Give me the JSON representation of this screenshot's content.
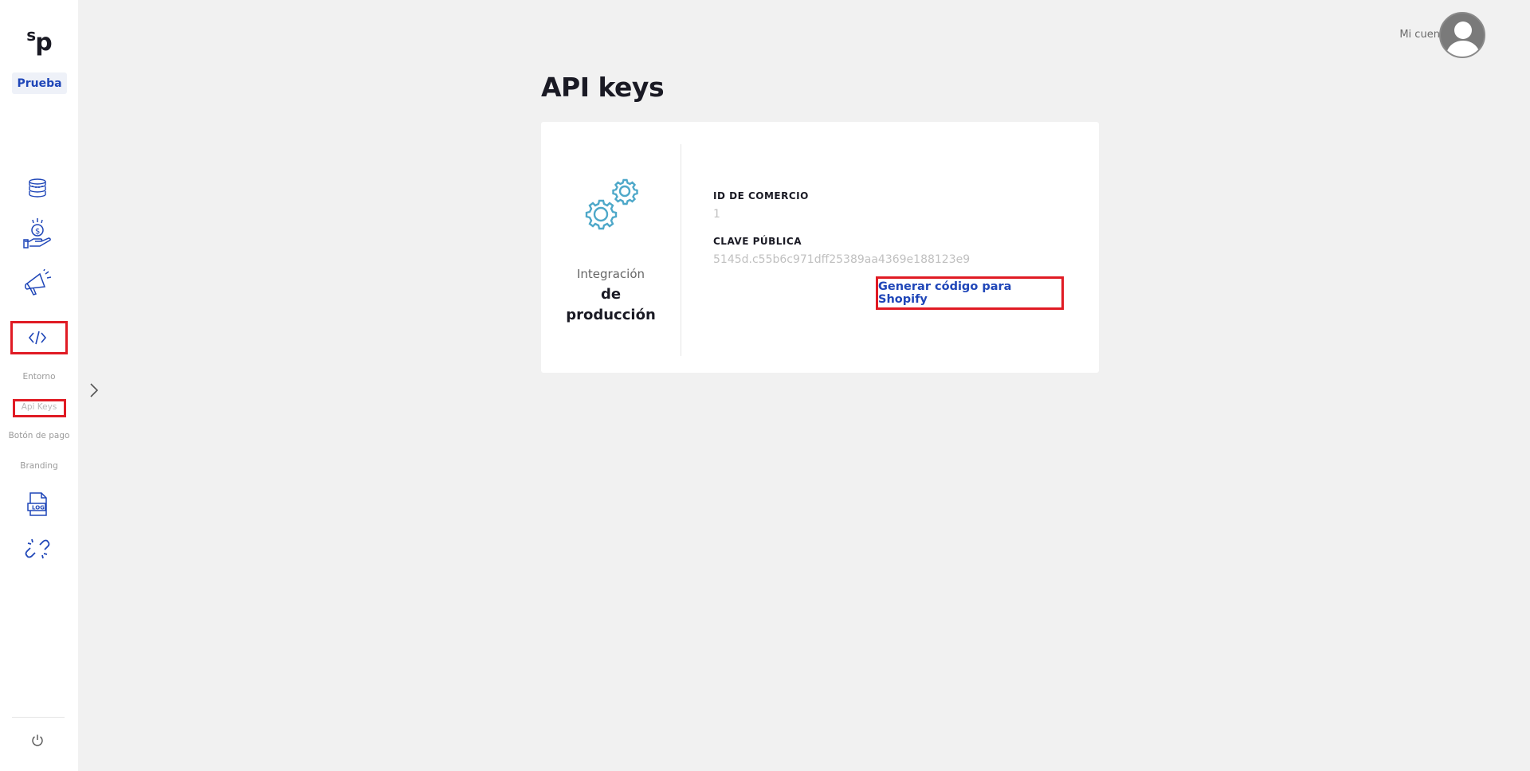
{
  "sidebar": {
    "logo": {
      "s": "s",
      "p": "p"
    },
    "env_badge": "Prueba",
    "icons": [
      "coins-stack-icon",
      "hand-money-icon",
      "megaphone-icon",
      "code-icon",
      "log-file-icon",
      "broken-link-icon"
    ],
    "sub_items": [
      {
        "label": "Entorno"
      },
      {
        "label": "Api Keys"
      },
      {
        "label": "Botón de pago"
      },
      {
        "label": "Branding"
      }
    ]
  },
  "header": {
    "account_label": "Mi cuenta"
  },
  "main": {
    "title": "API keys",
    "card": {
      "integration_label": "Integración",
      "integration_strong_1": "de",
      "integration_strong_2": "producción",
      "merchant_id_label": "ID DE COMERCIO",
      "merchant_id_value": "1",
      "public_key_label": "CLAVE PÚBLICA",
      "public_key_value": "5145d.c55b6c971dff25389aa4369e188123e9",
      "shopify_button": "Generar código para Shopify"
    }
  },
  "colors": {
    "brand_blue": "#1f46b8",
    "highlight_red": "#e01b24",
    "gear_teal": "#4ea8c9",
    "background": "#f1f1f1"
  }
}
